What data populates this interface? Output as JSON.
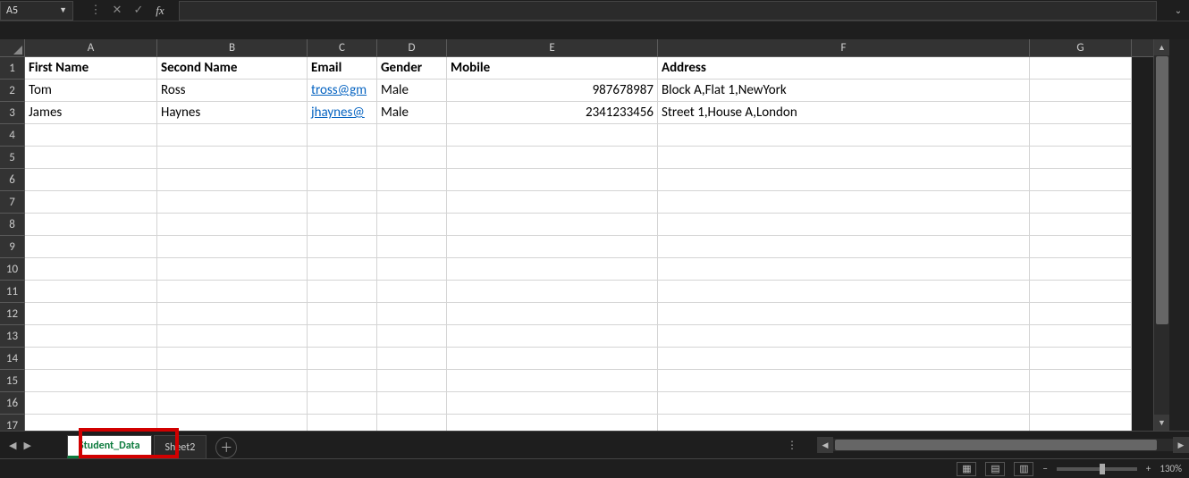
{
  "formula_bar": {
    "cell_ref": "A5",
    "fx_label": "fx",
    "formula_value": ""
  },
  "columns": [
    {
      "letter": "A",
      "cls": "cA"
    },
    {
      "letter": "B",
      "cls": "cB"
    },
    {
      "letter": "C",
      "cls": "cC"
    },
    {
      "letter": "D",
      "cls": "cD"
    },
    {
      "letter": "E",
      "cls": "cE"
    },
    {
      "letter": "F",
      "cls": "cF"
    },
    {
      "letter": "G",
      "cls": "cG"
    }
  ],
  "row_numbers": [
    "1",
    "2",
    "3",
    "4",
    "5",
    "6",
    "7",
    "8",
    "9",
    "10",
    "11",
    "12",
    "13",
    "14",
    "15",
    "16",
    "17"
  ],
  "headers": {
    "A": "First Name",
    "B": "Second Name",
    "C": "Email",
    "D": "Gender",
    "E": "Mobile",
    "F": "Address",
    "G": ""
  },
  "data_rows": [
    {
      "A": "Tom",
      "B": "Ross",
      "C": "tross@gm",
      "C_link": true,
      "D": "Male",
      "E": "987678987",
      "E_num": true,
      "F": "Block A,Flat 1,NewYork",
      "G": ""
    },
    {
      "A": "James",
      "B": "Haynes",
      "C": "jhaynes@",
      "C_link": true,
      "D": "Male",
      "E": "2341233456",
      "E_num": true,
      "F": "Street 1,House A,London",
      "G": ""
    }
  ],
  "sheet_tabs": {
    "active": "Student_Data",
    "other": "Sheet2"
  },
  "status": {
    "zoom": "130%"
  }
}
